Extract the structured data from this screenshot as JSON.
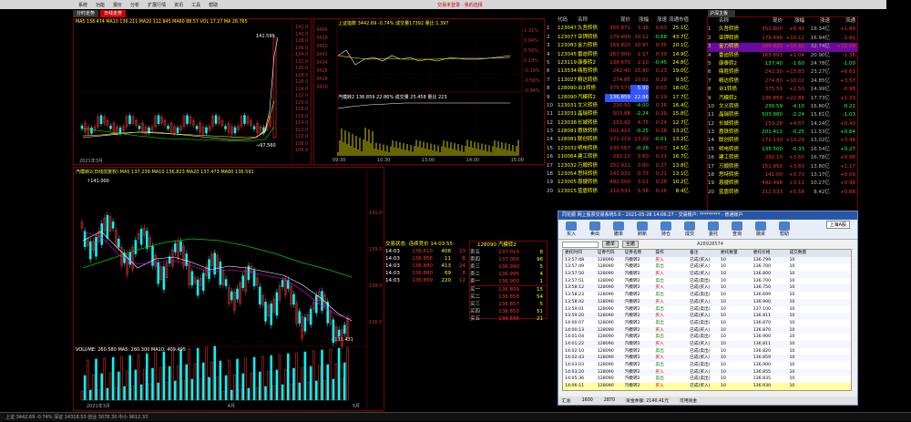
{
  "menu": [
    "系统",
    "功能",
    "报价",
    "分析",
    "扩展行情",
    "资讯",
    "工具",
    "帮助"
  ],
  "menu_center": "交易未登录 · 我的选择",
  "tabs": [
    "分时走势",
    "日线走势"
  ],
  "top_chart": {
    "info": "MA5 138.474  MA10 136.211 MA20 112.845 MA60 88.57  VOL 17.27  MA 28.765",
    "peak_label": "141.599",
    "low_label": "→97.560",
    "date_label": "2021年3月",
    "right_scale": [
      "142.0",
      "140.0",
      "138.0",
      "136.0",
      "134.0",
      "132.0",
      "130.0",
      "128.0",
      "126.0",
      "124.0",
      "122.0",
      "120.0",
      "118.0",
      "116.0",
      "114.0",
      "112.0",
      "110.0",
      "108.0",
      "106.0"
    ]
  },
  "intraday": {
    "header": "上证指数 3442.69 -0.74% 成交量17392 量比 1.397",
    "sub_header": "汽模转2 136.859 22.86% 成交量 25.458 量比 223",
    "left_scale": [
      "3466",
      "3458",
      "3450",
      "3442",
      "3434",
      "3426",
      "3418",
      "3410"
    ],
    "right_pct": [
      "1.31%",
      "0.94%",
      "0.56%",
      "0.19%",
      "-0.19%",
      "-0.56%",
      "-0.94%"
    ],
    "time_labels": [
      "09:30",
      "10:30",
      "13:00",
      "14:00",
      "15:00"
    ]
  },
  "quote_header": [
    "",
    "代码",
    "名称",
    "现价",
    "涨幅",
    "涨速",
    "涨幅%",
    "流通市值"
  ],
  "quotes": [
    [
      "1",
      "123047",
      "久吾转债",
      "350.871",
      "3.36",
      "0.63",
      "25.1亿"
    ],
    [
      "2",
      "123077",
      "亚钾转债",
      "179.499",
      "10.12",
      "-0.68",
      "43.7亿"
    ],
    [
      "3",
      "123083",
      "金力转债",
      "169.820",
      "10.97",
      "0.35",
      "20.1亿"
    ],
    [
      "4",
      "123045",
      "雷迪转债",
      "267.000",
      "1.17",
      "0.39",
      "14.9亿"
    ],
    [
      "5",
      "123119",
      "康泰转2",
      "138.670",
      "2.10",
      "-0.45",
      "24.8亿"
    ],
    [
      "6",
      "113534",
      "鼎胜转债",
      "242.40",
      "15.80",
      "0.23",
      "19.0亿"
    ],
    [
      "7",
      "113027",
      "精达转债",
      "274.85",
      "10.02",
      "0.29",
      "9.5亿"
    ],
    [
      "8",
      "128090",
      "台1转债",
      "375.573",
      "5.90",
      "0.03",
      "18.0亿"
    ],
    [
      "9",
      "128090",
      "汽模转2",
      "136.859",
      "22.86",
      "0.29",
      "17.7亿"
    ],
    [
      "10",
      "123031",
      "文义转债",
      "230.50",
      "-4.00",
      "0.26",
      "16.4亿"
    ],
    [
      "11",
      "123031",
      "晶瑞转债",
      "503.88",
      "-2.24",
      "0.29",
      "15.8亿"
    ],
    [
      "12",
      "123038",
      "长城转债",
      "153.92",
      "4.75",
      "0.24",
      "12.7亿"
    ],
    [
      "13",
      "128081",
      "惠铁转债",
      "201.411",
      "-0.25",
      "0.28",
      "13.2亿"
    ],
    [
      "14",
      "128081",
      "联创转债",
      "171.119",
      "13.29",
      "-0.01",
      "13.2亿"
    ],
    [
      "15",
      "123032",
      "明电转债",
      "135.567",
      "-0.28",
      "0.03",
      "14.5亿"
    ],
    [
      "16",
      "110064",
      "建工转债",
      "292.10",
      "3.60",
      "0.21",
      "16.7亿"
    ],
    [
      "17",
      "123032",
      "万顺转债",
      "151.921",
      "3.60",
      "0.27",
      "13.8亿"
    ],
    [
      "18",
      "123054",
      "思特转债",
      "141.031",
      "0.73",
      "0.21",
      "13.1亿"
    ],
    [
      "19",
      "123005",
      "恩捷转债",
      "492.500",
      "3.11",
      "0.28",
      "10.2亿"
    ],
    [
      "20",
      "123015",
      "蓝盾转债",
      "212.533",
      "5.58",
      "0.26",
      "8.4亿"
    ]
  ],
  "right_header": [
    "",
    "名称",
    "现价",
    "涨幅",
    "涨速",
    "流通"
  ],
  "right_tab": "沪深主板",
  "right_quotes": [
    [
      "1",
      "久吾转债",
      "351.800",
      "+8.40",
      "18.34亿",
      "+1.89"
    ],
    [
      "2",
      "亚钾转债",
      "179.499",
      "+10.12",
      "16.94亿",
      "-1.91"
    ],
    [
      "3",
      "金力转债",
      "169.820",
      "+10.92",
      "32.74亿",
      "+11.09"
    ],
    [
      "4",
      "雷迪转债",
      "265.693",
      "+1.04",
      "20.90亿",
      "-1.36"
    ],
    [
      "5",
      "康泰转2",
      "137.40",
      "-1.60",
      "24.78亿",
      "-1.00"
    ],
    [
      "6",
      "鼎胜转债",
      "242.30",
      "+15.83",
      "23.27亿",
      "+6.61"
    ],
    [
      "7",
      "精达转债",
      "274.80",
      "+10.02",
      "24.85亿",
      "+3.57"
    ],
    [
      "8",
      "台1转债",
      "375.51",
      "+2.50",
      "14.99亿",
      "-0.98"
    ],
    [
      "9",
      "汽模转2",
      "136.859",
      "+22.86",
      "17.73亿",
      "+1.23"
    ],
    [
      "10",
      "文义转债",
      "230.59",
      "-4.10",
      "16.80亿",
      "-0.22"
    ],
    [
      "11",
      "晶瑞转债",
      "503.880",
      "-2.24",
      "15.81亿",
      "-1.03"
    ],
    [
      "12",
      "长城转债",
      "153.28",
      "+4.67",
      "14.24亿",
      "+0.43"
    ],
    [
      "13",
      "惠铁转债",
      "201.411",
      "-0.25",
      "11.53亿",
      "+0.64"
    ],
    [
      "14",
      "联创转债",
      "171.130",
      "+13.29",
      "13.02亿",
      "+3.48"
    ],
    [
      "15",
      "明电转债",
      "135.500",
      "-0.33",
      "16.54亿",
      "+0.27"
    ],
    [
      "16",
      "建工转债",
      "292.10",
      "+3.60",
      "16.78亿",
      "+0.98"
    ],
    [
      "17",
      "万顺转债",
      "151.950",
      "+3.60",
      "13.80亿",
      "+1.17"
    ],
    [
      "18",
      "思特转债",
      "141.00",
      "+0.73",
      "13.17亿",
      "+0.09"
    ],
    [
      "19",
      "恩捷转债",
      "492.498",
      "+3.11",
      "10.27亿",
      "+0.98"
    ],
    [
      "20",
      "蓝盾转债",
      "212.533",
      "+5.58",
      "8.42亿",
      "+0.88"
    ]
  ],
  "kline": {
    "info": "汽模转2(日线前复权) MA5 137.239 MA10 136.823 MA20 137.473 MA60 136.591",
    "price_label": "↑141.000",
    "low_label": "→135.431",
    "right_scale": [
      "141.0",
      "139.5",
      "138.0",
      "136.5",
      "135.0"
    ],
    "vol_info": "VOLUME: 260.580 MA5: 260.300 MA10: 409.495",
    "vol_scale": [
      "400",
      "200",
      "0"
    ],
    "date_labels": [
      "2021年3月",
      "4月",
      "5月"
    ]
  },
  "trade_ticks": {
    "title": "交易状态: 连续竞价 14:03:55",
    "rows": [
      [
        "14:03",
        "136.610",
        "408",
        "23"
      ],
      [
        "14:03",
        "136.856",
        "11",
        "B"
      ],
      [
        "14:03",
        "136.880",
        "413",
        "24"
      ],
      [
        "14:03",
        "136.880",
        "69",
        "8"
      ],
      [
        "14:03",
        "136.859",
        "220",
        "12"
      ]
    ]
  },
  "orderbook": {
    "title": "128090 汽模转2",
    "rows": [
      [
        "卖五",
        "137.010",
        "8"
      ],
      [
        "卖四",
        "137.000",
        "96"
      ],
      [
        "卖三",
        "136.990",
        "5"
      ],
      [
        "卖二",
        "136.995",
        "4"
      ],
      [
        "卖一",
        "136.900",
        "1"
      ],
      [
        "买一",
        "136.859",
        "15"
      ],
      [
        "买二",
        "136.858",
        "54"
      ],
      [
        "买三",
        "136.857",
        "5"
      ],
      [
        "买四",
        "136.855",
        "51"
      ],
      [
        "买五",
        "136.835",
        "21"
      ]
    ]
  },
  "dialog": {
    "title": "同花顺 网上股票交易系统5.0 - 2021-05-28 14:06:27 - 交易账户: ********* - 普通账户",
    "account_select": "上海A股",
    "account_no": "A28928574",
    "toolbar": [
      "买入",
      "卖出",
      "撤单",
      "刷新",
      "持仓",
      "成交",
      "委托",
      "查询",
      "融资",
      "帮助"
    ],
    "filter_label": "撤单",
    "filter_btn1": "撤单",
    "filter_btn2": "全撤",
    "columns": [
      "委托时间",
      "证券代码",
      "证券名称",
      "操作",
      "备注",
      "委托数量",
      "委托价格",
      "成交数量"
    ],
    "rows": [
      [
        "13:57:48",
        "128090",
        "汽模转2",
        "买入",
        "已成(买入)",
        "10",
        "136.799",
        "10"
      ],
      [
        "13:57:49",
        "128090",
        "汽模转2",
        "卖出",
        "已成(买入)",
        "10",
        "136.700",
        "10"
      ],
      [
        "13:57:50",
        "128090",
        "汽模转2",
        "买入",
        "已成(买入)",
        "10",
        "136.800",
        "10"
      ],
      [
        "13:57:51",
        "128090",
        "汽模转2",
        "卖出",
        "已成(卖出)",
        "10",
        "136.700",
        "10"
      ],
      [
        "13:58:12",
        "128090",
        "汽模转2",
        "买入",
        "已成(买入)",
        "10",
        "136.750",
        "10"
      ],
      [
        "13:58:23",
        "128090",
        "汽模转2",
        "卖出",
        "已成(卖出)",
        "10",
        "136.699",
        "10"
      ],
      [
        "13:58:42",
        "128090",
        "汽模转2",
        "买入",
        "已成(买入)",
        "10",
        "136.900",
        "10"
      ],
      [
        "13:59:01",
        "128090",
        "汽模转2",
        "卖出",
        "已成(卖出)",
        "10",
        "137.100",
        "10"
      ],
      [
        "13:59:20",
        "128090",
        "汽模转2",
        "买入",
        "已成(买入)",
        "10",
        "136.811",
        "10"
      ],
      [
        "14:00:07",
        "128090",
        "汽模转2",
        "卖出",
        "已成(卖出)",
        "10",
        "136.870",
        "10"
      ],
      [
        "14:00:13",
        "128090",
        "汽模转2",
        "买入",
        "已成(买入)",
        "10",
        "136.870",
        "10"
      ],
      [
        "14:01:04",
        "128090",
        "汽模转2",
        "卖出",
        "已成(卖出)",
        "10",
        "136.900",
        "10"
      ],
      [
        "14:01:22",
        "128090",
        "汽模转2",
        "买入",
        "已成(买入)",
        "10",
        "136.811",
        "10"
      ],
      [
        "14:02:10",
        "128090",
        "汽模转2",
        "卖出",
        "已成(卖出)",
        "10",
        "136.820",
        "10"
      ],
      [
        "14:02:43",
        "128090",
        "汽模转2",
        "买入",
        "已成(买入)",
        "10",
        "136.859",
        "10"
      ],
      [
        "14:03:03",
        "128090",
        "汽模转2",
        "卖出",
        "已成(卖出)",
        "10",
        "136.900",
        "10"
      ],
      [
        "14:03:20",
        "128090",
        "汽模转2",
        "买入",
        "已成(买入)",
        "10",
        "136.855",
        "10"
      ],
      [
        "14:05:36",
        "128090",
        "汽模转2",
        "卖出",
        "已成(卖出)",
        "10",
        "136.835",
        "10"
      ],
      [
        "14:06:11",
        "128090",
        "汽模转2",
        "买入",
        "已成(买入)",
        "10",
        "136.930",
        "10"
      ]
    ],
    "status": [
      "汇总",
      "",
      "1600",
      "",
      "2870",
      "资金余额: 2140.41元",
      "可用资金"
    ]
  },
  "bottom": "上证 3442.69 -0.74%  深证 14318.53  创业 3078.30  中小 9612.33"
}
